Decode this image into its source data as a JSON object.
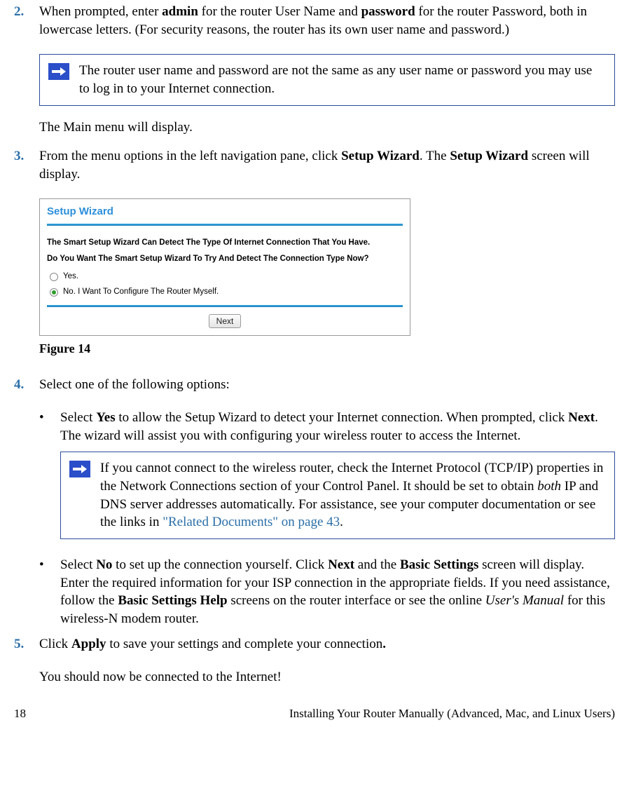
{
  "step2": {
    "num": "2.",
    "para": {
      "t1": "When prompted, enter ",
      "b1": "admin",
      "t2": " for the router User Name and ",
      "b2": "password",
      "t3": " for the router Password, both in lowercase letters. (For security reasons, the router has its own user name and password.)"
    }
  },
  "note1": "The router user name and password are not the same as any user name or password you may use to log in to your Internet connection.",
  "afterNote1": "The Main menu will display.",
  "step3": {
    "num": "3.",
    "t1": "From the menu options in the left navigation pane, click ",
    "b1": "Setup Wizard",
    "t2": ". The ",
    "b2": "Setup Wizard",
    "t3": " screen will display."
  },
  "wizard": {
    "title": "Setup Wizard",
    "q1": "The Smart Setup Wizard Can Detect The Type Of Internet Connection That You Have.",
    "q2": "Do You Want The Smart Setup Wizard To Try And Detect The Connection Type Now?",
    "yes": "Yes.",
    "no": "No. I Want To Configure The Router Myself.",
    "next": "Next"
  },
  "figCaption": "Figure 14",
  "step4": {
    "num": "4.",
    "intro": "Select one of the following options:",
    "bulletYes": {
      "t1": "Select ",
      "b1": "Yes",
      "t2": " to allow the Setup Wizard to detect your Internet connection. When prompted, click ",
      "b2": "Next",
      "t3": ". The wizard will assist you with configuring your wireless router to access the Internet."
    },
    "note2": {
      "t1": "If you cannot connect to the wireless router, check the Internet Protocol (TCP/IP) properties in the Network Connections section of your Control Panel. It should be set to obtain ",
      "i1": "both",
      "t2": " IP and DNS server addresses automatically. For assistance, see your computer documentation or see the links in  ",
      "link": "\"Related Documents\" on page 43",
      "t3": "."
    },
    "bulletNo": {
      "t1": "Select ",
      "b1": "No",
      "t2": " to set up the connection yourself. Click ",
      "b2": "Next",
      "t3": " and the ",
      "b3": "Basic Settings",
      "t4": " screen will display. Enter the required information for your ISP connection in the appropriate fields. If you need assistance, follow the ",
      "b4": "Basic Settings Help",
      "t5": " screens on the router interface or see the online ",
      "i1": "User's Manual",
      "t6": " for this wireless-N modem router."
    }
  },
  "step5": {
    "num": "5.",
    "t1": "Click ",
    "b1": "Apply",
    "t2": " to save your settings and complete your connection",
    "b2": "."
  },
  "afterStep5": "You should now be connected to the Internet!",
  "footer": {
    "page": "18",
    "title": "Installing Your Router Manually (Advanced, Mac, and Linux Users)"
  }
}
